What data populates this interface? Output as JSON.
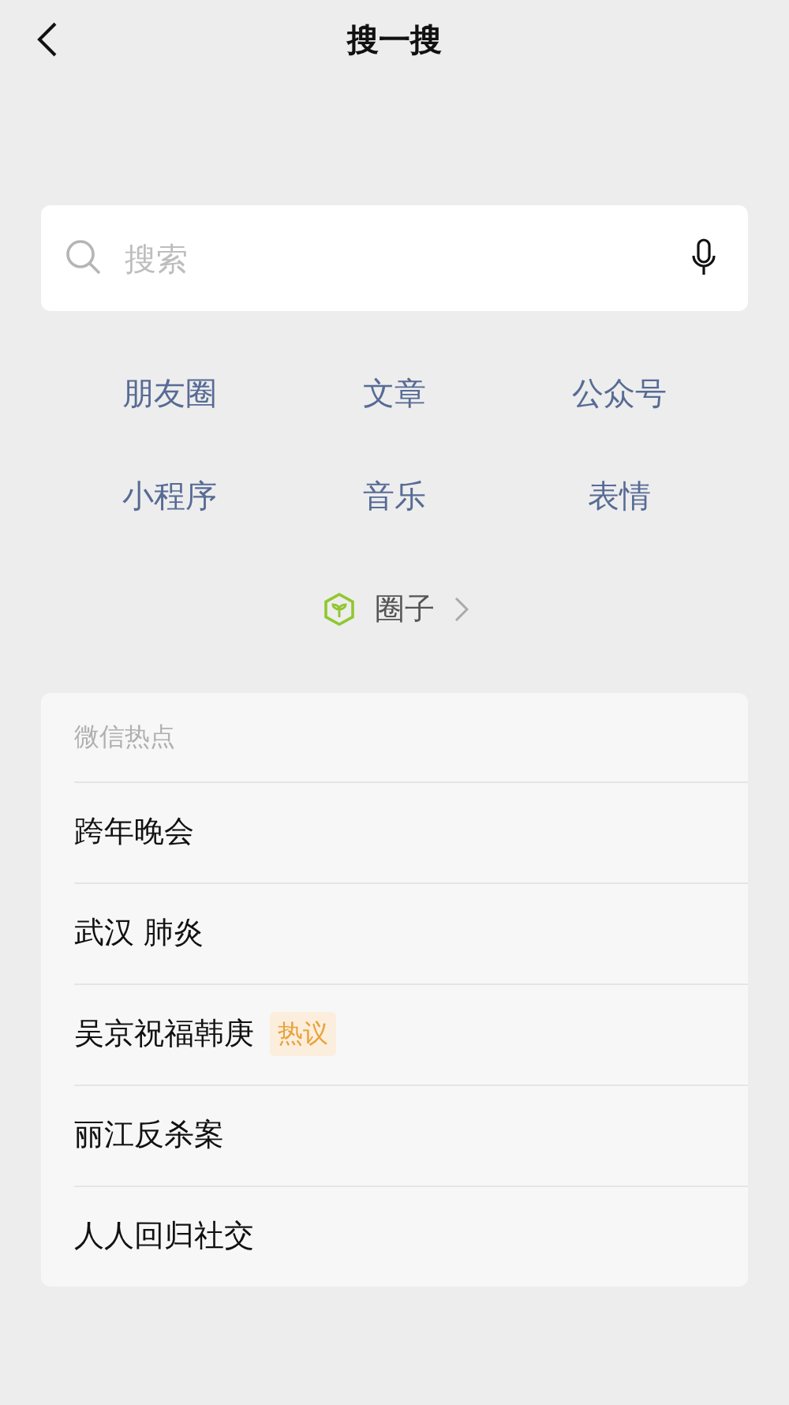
{
  "title": "搜一搜",
  "search": {
    "placeholder": "搜索"
  },
  "categories": [
    "朋友圈",
    "文章",
    "公众号",
    "小程序",
    "音乐",
    "表情"
  ],
  "circle_link": {
    "label": "圈子"
  },
  "hot": {
    "heading": "微信热点",
    "items": [
      {
        "text": "跨年晚会"
      },
      {
        "text": "武汉 肺炎"
      },
      {
        "text": "吴京祝福韩庚",
        "tag": "热议"
      },
      {
        "text": "丽江反杀案"
      },
      {
        "text": "人人回归社交"
      }
    ]
  }
}
